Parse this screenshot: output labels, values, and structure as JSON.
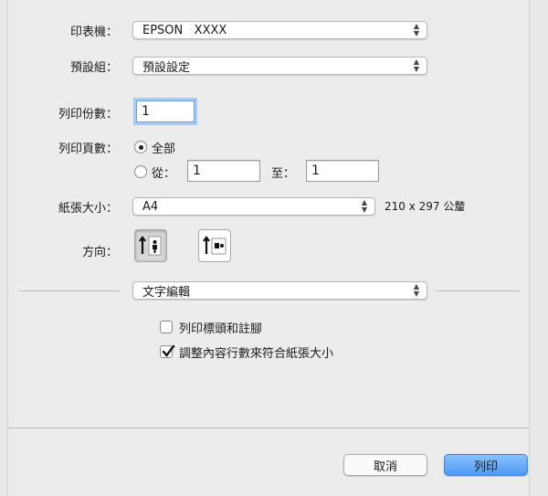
{
  "printer": {
    "label": "印表機：",
    "value": "EPSON   XXXX"
  },
  "presets": {
    "label": "預設組：",
    "value": "預設設定"
  },
  "copies": {
    "label": "列印份數：",
    "value": "1"
  },
  "pages": {
    "label": "列印頁數：",
    "all_label": "全部",
    "from_label": "從：",
    "from_value": "1",
    "to_label": "至：",
    "to_value": "1",
    "selected": "all"
  },
  "paper_size": {
    "label": "紙張大小：",
    "value": "A4",
    "dimensions": "210 x 297 公釐"
  },
  "orientation": {
    "label": "方向：",
    "selected": "portrait"
  },
  "section_menu": {
    "value": "文字編輯"
  },
  "options": {
    "print_headers_footers": {
      "label": "列印標頭和註腳",
      "checked": false
    },
    "rewrap_contents": {
      "label": "調整內容行數來符合紙張大小",
      "checked": true
    }
  },
  "buttons": {
    "cancel": "取消",
    "print": "列印"
  },
  "colors": {
    "accent": "#4a9af4",
    "focus_ring": "#a8c9f3"
  }
}
